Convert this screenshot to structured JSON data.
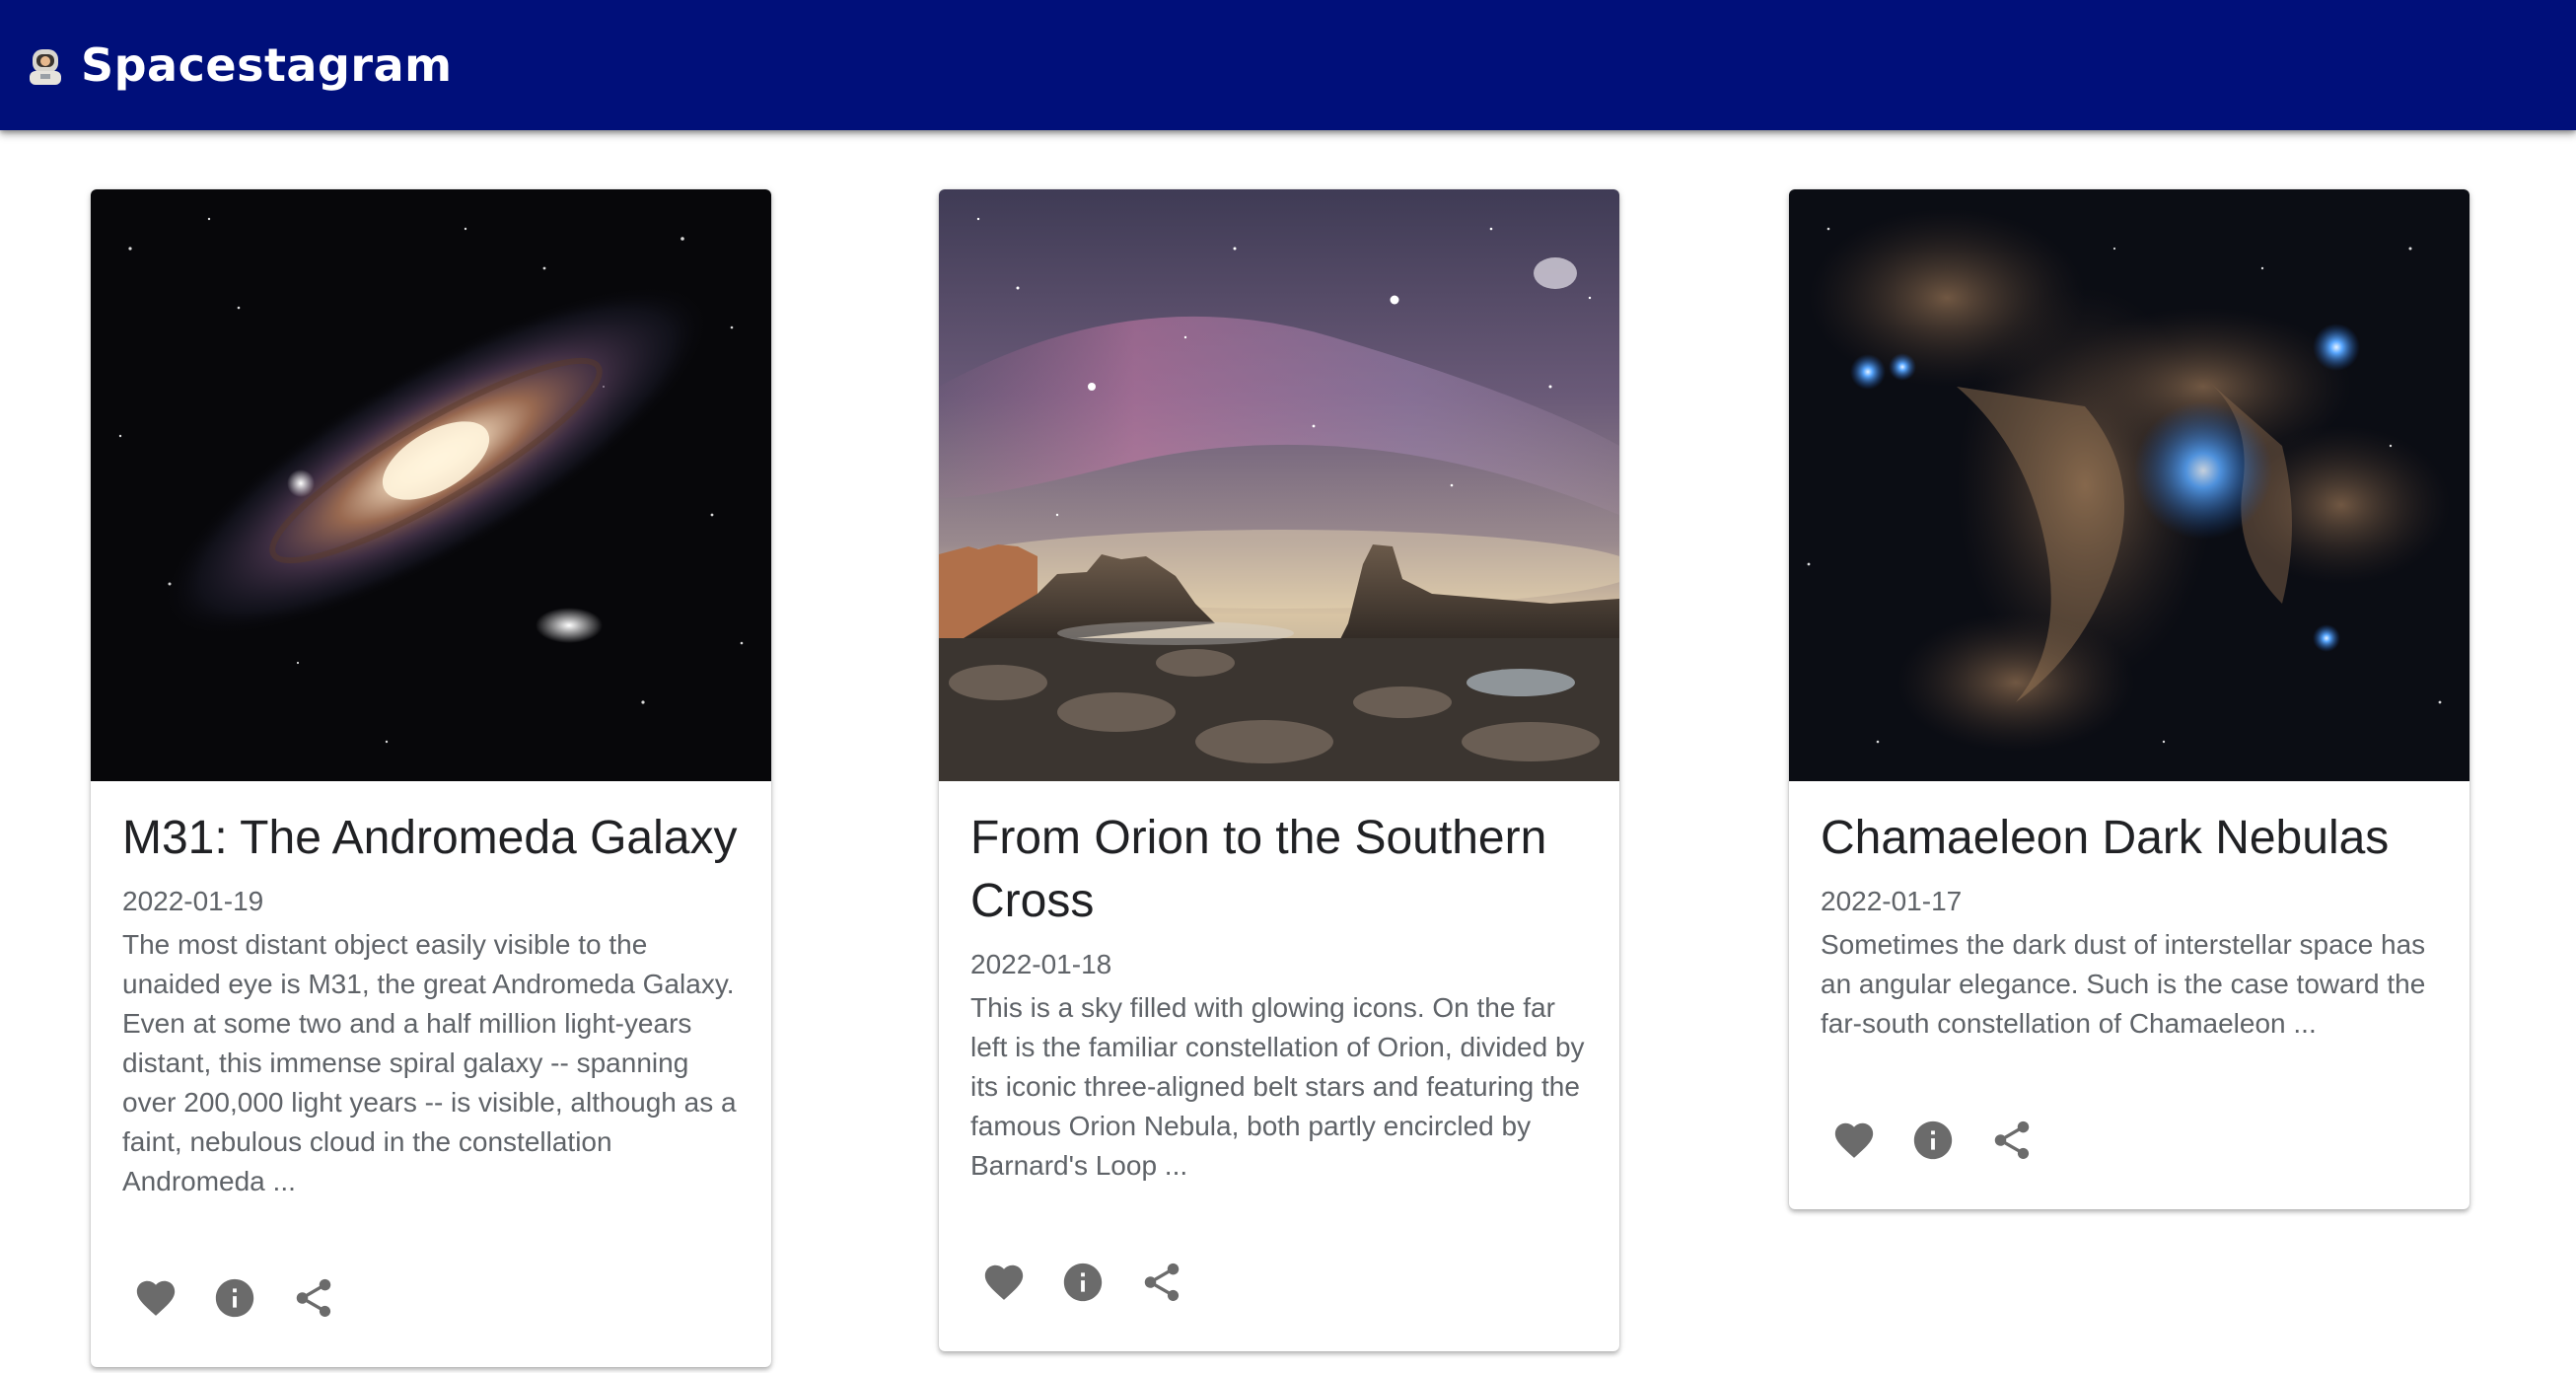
{
  "app": {
    "title": "Spacestagram",
    "logo_icon": "astronaut-icon"
  },
  "colors": {
    "appbar": "#000f7a",
    "action_icon": "#6b6b6b",
    "body_text": "#5f6368"
  },
  "cards": [
    {
      "image_alt": "Andromeda galaxy photograph",
      "title": "M31: The Andromeda Galaxy",
      "date": "2022-01-19",
      "description": "The most distant object easily visible to the unaided eye is M31, the great Andromeda Galaxy. Even at some two and a half million light-years distant, this immense spiral galaxy -- spanning over 200,000 light years -- is visible, although as a faint, nebulous cloud in the constellation Andromeda ...",
      "actions": [
        "heart-icon",
        "info-icon",
        "share-icon"
      ]
    },
    {
      "image_alt": "Night sky over rocky coast photograph",
      "title": "From Orion to the Southern Cross",
      "date": "2022-01-18",
      "description": "This is a sky filled with glowing icons. On the far left is the familiar constellation of Orion, divided by its iconic three-aligned belt stars and featuring the famous Orion Nebula, both partly encircled by Barnard's Loop ...",
      "actions": [
        "heart-icon",
        "info-icon",
        "share-icon"
      ]
    },
    {
      "image_alt": "Chamaeleon dark nebulas photograph",
      "title": "Chamaeleon Dark Nebulas",
      "date": "2022-01-17",
      "description": "Sometimes the dark dust of interstellar space has an angular elegance. Such is the case toward the far-south constellation of Chamaeleon ...",
      "actions": [
        "heart-icon",
        "info-icon",
        "share-icon"
      ]
    }
  ]
}
